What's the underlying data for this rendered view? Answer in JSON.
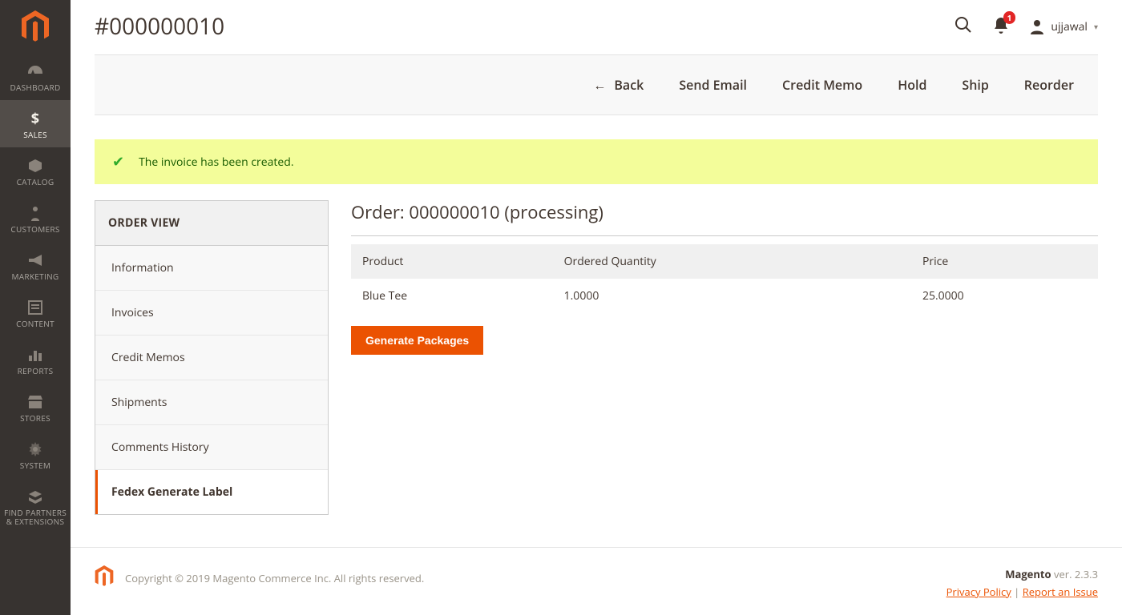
{
  "page_title": "#000000010",
  "user": {
    "name": "ujjawal"
  },
  "notifications": {
    "count": "1"
  },
  "nav": [
    {
      "label": "DASHBOARD"
    },
    {
      "label": "SALES"
    },
    {
      "label": "CATALOG"
    },
    {
      "label": "CUSTOMERS"
    },
    {
      "label": "MARKETING"
    },
    {
      "label": "CONTENT"
    },
    {
      "label": "REPORTS"
    },
    {
      "label": "STORES"
    },
    {
      "label": "SYSTEM"
    },
    {
      "label": "FIND PARTNERS & EXTENSIONS"
    }
  ],
  "actions": {
    "back": "Back",
    "send_email": "Send Email",
    "credit_memo": "Credit Memo",
    "hold": "Hold",
    "ship": "Ship",
    "reorder": "Reorder"
  },
  "message": "The invoice has been created.",
  "side_panel": {
    "title": "ORDER VIEW",
    "items": [
      {
        "label": "Information"
      },
      {
        "label": "Invoices"
      },
      {
        "label": "Credit Memos"
      },
      {
        "label": "Shipments"
      },
      {
        "label": "Comments History"
      },
      {
        "label": "Fedex Generate Label"
      }
    ]
  },
  "order": {
    "title": "Order: 000000010 (processing)",
    "columns": {
      "product": "Product",
      "qty": "Ordered Quantity",
      "price": "Price"
    },
    "rows": [
      {
        "product": "Blue Tee",
        "qty": "1.0000",
        "price": "25.0000"
      }
    ],
    "generate_btn": "Generate Packages"
  },
  "footer": {
    "copyright": "Copyright © 2019 Magento Commerce Inc. All rights reserved.",
    "brand": "Magento",
    "version": " ver. 2.3.3",
    "privacy": "Privacy Policy",
    "sep": " | ",
    "report": "Report an Issue"
  }
}
